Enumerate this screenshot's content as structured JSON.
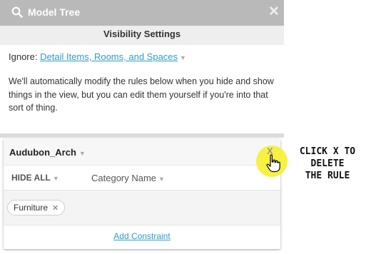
{
  "header": {
    "title": "Model Tree",
    "close_glyph": "✕",
    "search_icon": "search-icon"
  },
  "subheader": {
    "title": "Visibility Settings"
  },
  "ignore": {
    "label": "Ignore:",
    "link_text": "Detail Items, Rooms, and Spaces"
  },
  "description": "We'll automatically modify the rules below when you hide and show things in the view, but you can edit them yourself if you're into that sort of thing.",
  "rule": {
    "name": "Audubon_Arch",
    "hide_all_label": "HIDE ALL",
    "category_label": "Category Name",
    "tags": [
      {
        "label": "Furniture"
      }
    ],
    "add_constraint_label": "Add Constraint",
    "delete_glyph": "X"
  },
  "annotation": {
    "line1": "CLICK X TO",
    "line2": "DELETE",
    "line3": "THE RULE"
  },
  "colors": {
    "titlebar": "#b9b9b9",
    "link": "#2e9cc8",
    "highlight": "#f5f032"
  }
}
